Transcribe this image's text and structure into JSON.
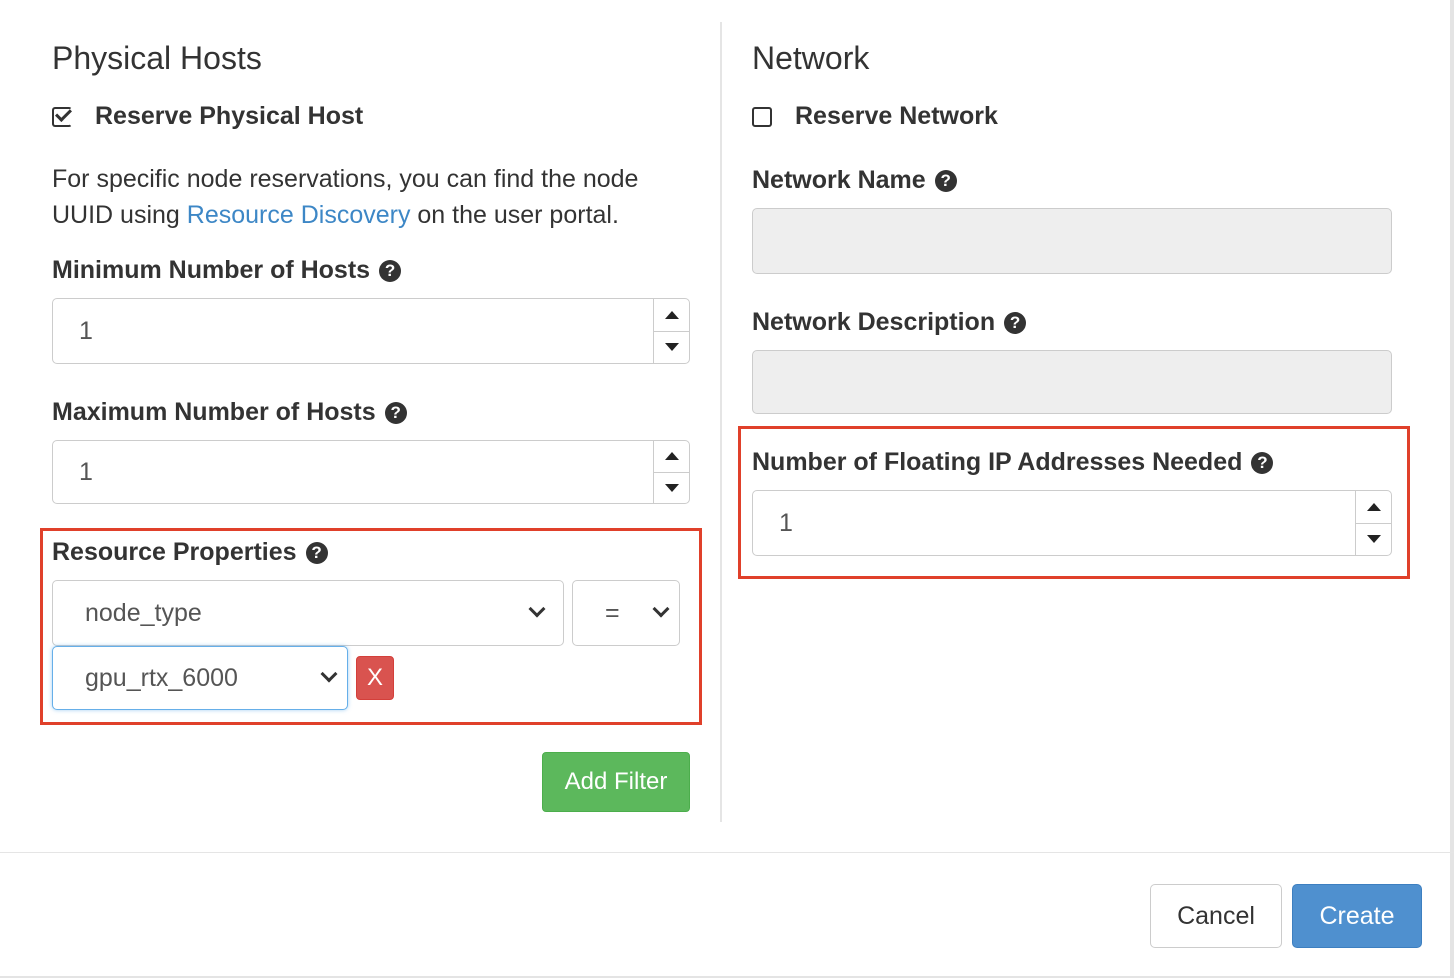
{
  "physical_hosts": {
    "title": "Physical Hosts",
    "reserve_label": "Reserve Physical Host",
    "reserve_checked": true,
    "help_text_prefix": "For specific node reservations, you can find the node UUID using ",
    "help_link_text": "Resource Discovery",
    "help_text_suffix": " on the user portal.",
    "min_hosts_label": "Minimum Number of Hosts",
    "min_hosts_value": "1",
    "max_hosts_label": "Maximum Number of Hosts",
    "max_hosts_value": "1",
    "resource_properties_label": "Resource Properties",
    "property_select_value": "node_type",
    "operator_select_value": "=",
    "value_select_value": "gpu_rtx_6000",
    "remove_label": "X",
    "add_filter_label": "Add Filter"
  },
  "network": {
    "title": "Network",
    "reserve_label": "Reserve Network",
    "reserve_checked": false,
    "name_label": "Network Name",
    "name_value": "",
    "description_label": "Network Description",
    "description_value": "",
    "floating_ip_label": "Number of Floating IP Addresses Needed",
    "floating_ip_value": "1"
  },
  "footer": {
    "cancel_label": "Cancel",
    "create_label": "Create"
  },
  "icons": {
    "help": "question-circle-icon"
  },
  "colors": {
    "link": "#3d87c6",
    "highlight": "#e0402a",
    "success": "#5cb85c",
    "danger": "#d9534f",
    "primary": "#4f90cf"
  }
}
